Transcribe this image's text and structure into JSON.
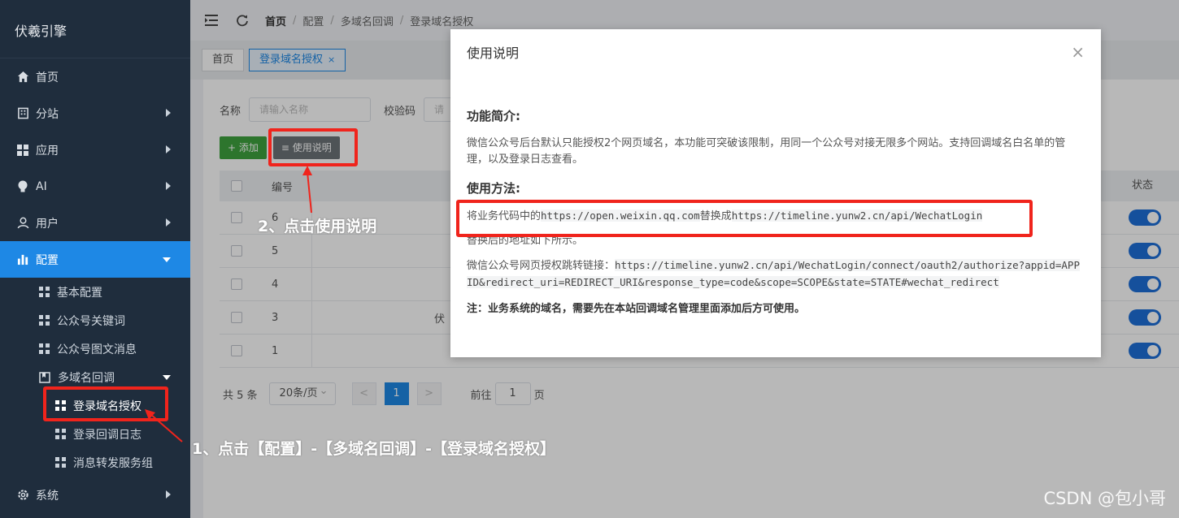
{
  "brand": "伏羲引擎",
  "sidebar": {
    "items": [
      {
        "label": "首页",
        "icon": "home-icon"
      },
      {
        "label": "分站",
        "icon": "building-icon"
      },
      {
        "label": "应用",
        "icon": "apps-icon"
      },
      {
        "label": "AI",
        "icon": "bulb-icon"
      },
      {
        "label": "用户",
        "icon": "user-icon"
      },
      {
        "label": "配置",
        "icon": "chart-icon"
      }
    ],
    "config_children": [
      "基本配置",
      "公众号关键词",
      "公众号图文消息",
      "多域名回调"
    ],
    "domain_children": [
      "登录域名授权",
      "登录回调日志",
      "消息转发服务组"
    ],
    "system": "系统"
  },
  "breadcrumb": [
    "首页",
    "配置",
    "多域名回调",
    "登录域名授权"
  ],
  "tabs": [
    {
      "label": "首页"
    },
    {
      "label": "登录域名授权",
      "close": "×"
    }
  ],
  "filter": {
    "name_label": "名称",
    "name_placeholder": "请输入名称",
    "code_label": "校验码",
    "code_placeholder": "请"
  },
  "actions": {
    "add": "+ 添加",
    "help": "使用说明"
  },
  "table": {
    "col_id": "编号",
    "col_status": "状态",
    "rows": [
      {
        "id": "6",
        "name": ""
      },
      {
        "id": "5",
        "name": ""
      },
      {
        "id": "4",
        "name": ""
      },
      {
        "id": "3",
        "name": "伏"
      },
      {
        "id": "1",
        "name": ""
      }
    ]
  },
  "pager": {
    "total": "共 5 条",
    "page_size": "20条/页",
    "prev": "<",
    "current": "1",
    "next": ">",
    "goto_prefix": "前往",
    "goto_value": "1",
    "goto_suffix": "页"
  },
  "modal": {
    "title": "使用说明",
    "close": "×",
    "intro_heading": "功能简介:",
    "intro_text": "微信公众号后台默认只能授权2个网页域名，本功能可突破该限制，用同一个公众号对接无限多个网站。支持回调域名白名单的管理，以及登录日志查看。",
    "method_heading": "使用方法:",
    "replace_prefix": "将业务代码中的",
    "replace_from": "https://open.weixin.qq.com",
    "replace_mid": "替换成",
    "replace_to": "https://timeline.yunw2.cn/api/WechatLogin",
    "after_replace": "替换后的地址如下所示。",
    "link_label": "微信公众号网页授权跳转链接：",
    "link_url": "https://timeline.yunw2.cn/api/WechatLogin/connect/oauth2/authorize?appid=APPID&redirect_uri=REDIRECT_URI&response_type=code&scope=SCOPE&state=STATE#wechat_redirect",
    "note": "注：业务系统的域名，需要先在本站回调域名管理里面添加后方可使用。"
  },
  "annotations": {
    "step1": "1、点击【配置】-【多域名回调】-【登录域名授权】",
    "step2": "2、点击使用说明"
  },
  "watermark": "CSDN @包小哥",
  "colors": {
    "sidebar_bg": "#1f2d3d",
    "accent": "#1e88e5",
    "annotation_red": "#f0241c",
    "add_green": "#3fa33f"
  }
}
